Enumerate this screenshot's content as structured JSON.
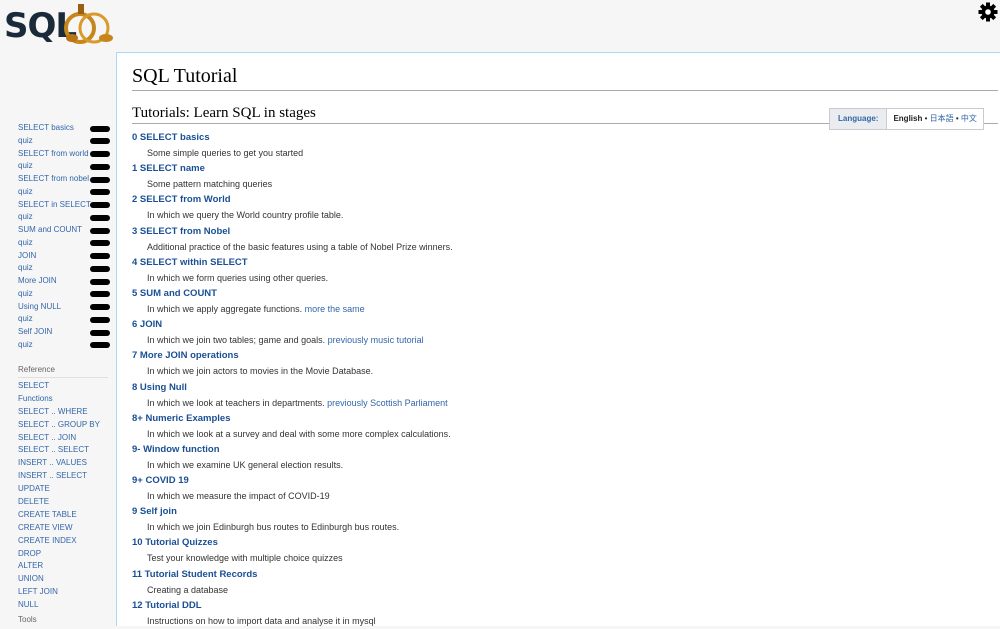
{
  "logo": {
    "text": "SQLZOO"
  },
  "header": {
    "settings_icon": "gear-icon"
  },
  "sidebar": {
    "tutorial_links": [
      {
        "label": "SELECT basics"
      },
      {
        "label": "quiz"
      },
      {
        "label": "SELECT from world"
      },
      {
        "label": "quiz"
      },
      {
        "label": "SELECT from nobel"
      },
      {
        "label": "quiz"
      },
      {
        "label": "SELECT in SELECT"
      },
      {
        "label": "quiz"
      },
      {
        "label": "SUM and COUNT"
      },
      {
        "label": "quiz"
      },
      {
        "label": "JOIN"
      },
      {
        "label": "quiz"
      },
      {
        "label": "More JOIN"
      },
      {
        "label": "quiz"
      },
      {
        "label": "Using NULL"
      },
      {
        "label": "quiz"
      },
      {
        "label": "Self JOIN"
      },
      {
        "label": "quiz"
      }
    ],
    "reference_label": "Reference",
    "reference_links": [
      "SELECT",
      "Functions",
      "SELECT .. WHERE",
      "SELECT .. GROUP BY",
      "SELECT .. JOIN",
      "SELECT .. SELECT",
      "INSERT .. VALUES",
      "INSERT .. SELECT",
      "UPDATE",
      "DELETE",
      "CREATE TABLE",
      "CREATE VIEW",
      "CREATE INDEX",
      "DROP",
      "ALTER",
      "UNION",
      "LEFT JOIN",
      "NULL"
    ],
    "tools_label": "Tools"
  },
  "main": {
    "title": "SQL Tutorial",
    "section_heading": "Tutorials: Learn SQL in stages",
    "language": {
      "label": "Language:",
      "current": "English",
      "separator": "•",
      "others": [
        "日本語",
        "中文"
      ]
    },
    "tutorials": [
      {
        "title": "0 SELECT basics",
        "desc": "Some simple queries to get you started",
        "extra": ""
      },
      {
        "title": "1 SELECT name",
        "desc": "Some pattern matching queries",
        "extra": ""
      },
      {
        "title": "2 SELECT from World",
        "desc": "In which we query the World country profile table.",
        "extra": ""
      },
      {
        "title": "3 SELECT from Nobel",
        "desc": "Additional practice of the basic features using a table of Nobel Prize winners.",
        "extra": ""
      },
      {
        "title": "4 SELECT within SELECT",
        "desc": "In which we form queries using other queries.",
        "extra": ""
      },
      {
        "title": "5 SUM and COUNT",
        "desc": "In which we apply aggregate functions.",
        "extra": "more the same"
      },
      {
        "title": "6 JOIN",
        "desc": "In which we join two tables; game and goals.",
        "extra": "previously music tutorial"
      },
      {
        "title": "7 More JOIN operations",
        "desc": "In which we join actors to movies in the Movie Database.",
        "extra": ""
      },
      {
        "title": "8 Using Null",
        "desc": "In which we look at teachers in departments.",
        "extra": "previously Scottish Parliament"
      },
      {
        "title": "8+ Numeric Examples",
        "desc": "In which we look at a survey and deal with some more complex calculations.",
        "extra": ""
      },
      {
        "title": "9- Window function",
        "desc": "In which we examine UK general election results.",
        "extra": ""
      },
      {
        "title": "9+ COVID 19",
        "desc": "In which we measure the impact of COVID-19",
        "extra": ""
      },
      {
        "title": "9 Self join",
        "desc": "In which we join Edinburgh bus routes to Edinburgh bus routes.",
        "extra": ""
      },
      {
        "title": "10 Tutorial Quizzes",
        "desc": "Test your knowledge with multiple choice quizzes",
        "extra": ""
      },
      {
        "title": "11 Tutorial Student Records",
        "desc": "Creating a database",
        "extra": ""
      },
      {
        "title": "12 Tutorial DDL",
        "desc": "Instructions on how to import data and analyse it in mysql",
        "extra": ""
      }
    ]
  }
}
